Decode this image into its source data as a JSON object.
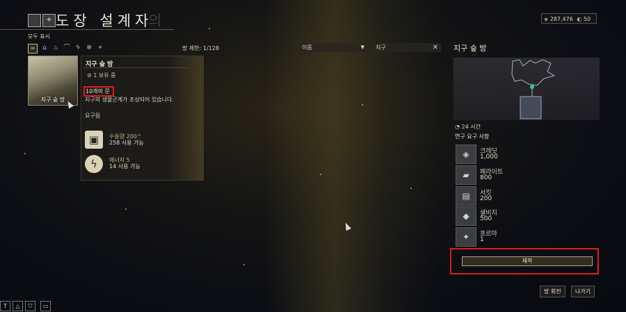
{
  "header": {
    "title": "도장 설계자",
    "title_fade": "의",
    "filter_label": "모두 표시",
    "room_limit": "방 제한: 1/128",
    "credits": "287,476",
    "platinum": "50"
  },
  "filters": {
    "sort_value": "이름",
    "search_value": "지구"
  },
  "room_tile": {
    "name": "지구 숲 방"
  },
  "tooltip": {
    "title": "지구 숲 방",
    "owned": "1 보유 중",
    "doors": "10개의 문",
    "description": "지구의 생물군계가 조성되어 있습니다.",
    "required_label": "요구됨",
    "requirements": [
      {
        "name": "수용량 200^",
        "available": "258 사용 가능"
      },
      {
        "name": "에너지 5",
        "available": "14 사용 가능"
      }
    ]
  },
  "detail": {
    "title": "지구 숲 방",
    "time": "24 시간",
    "research_label": "연구 요구 사항",
    "resources": [
      {
        "name": "크레딧",
        "amount": "1,000",
        "icon": "credits-icon"
      },
      {
        "name": "페라이트",
        "amount": "800",
        "icon": "ferrite-icon"
      },
      {
        "name": "서킷",
        "amount": "200",
        "icon": "circuits-icon"
      },
      {
        "name": "샐비지",
        "amount": "500",
        "icon": "salvage-icon"
      },
      {
        "name": "포르마",
        "amount": "1",
        "icon": "forma-icon"
      }
    ],
    "build_label": "제작"
  },
  "footer": {
    "rotate_label": "방 회전",
    "exit_label": "나가기"
  }
}
